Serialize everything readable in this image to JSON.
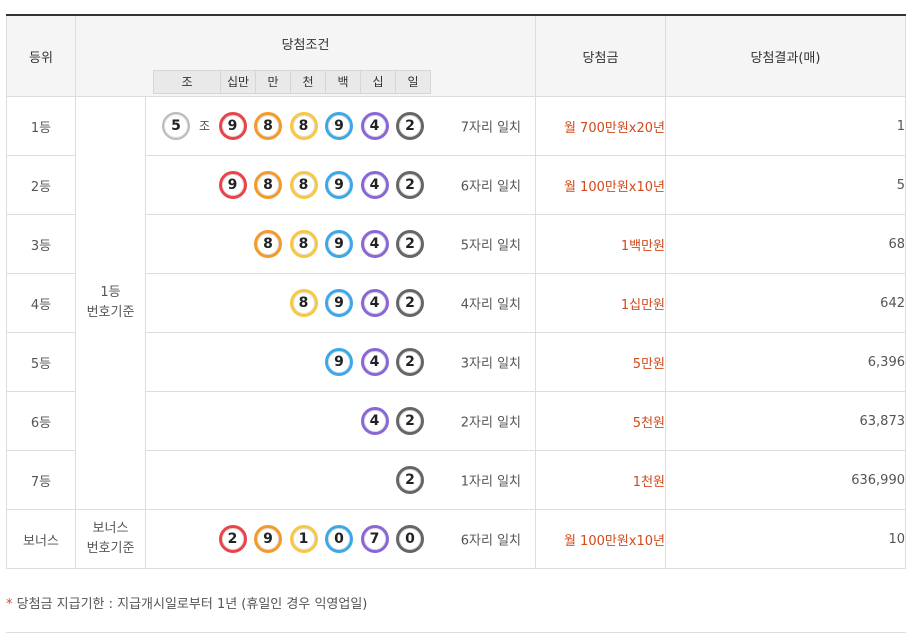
{
  "header": {
    "rank": "등위",
    "condition": "당첨조건",
    "prize": "당첨금",
    "result": "당첨결과(매)",
    "positions": [
      "조",
      "십만",
      "만",
      "천",
      "백",
      "십",
      "일"
    ]
  },
  "basis": {
    "main": "1등\n번호기준",
    "bonus": "보너스\n번호기준"
  },
  "jo_label": "조",
  "rows": [
    {
      "rank": "1등",
      "jo": "5",
      "digits": [
        "9",
        "8",
        "8",
        "9",
        "4",
        "2"
      ],
      "match": "7자리 일치",
      "prize": "월 700만원x20년",
      "result": "1"
    },
    {
      "rank": "2등",
      "digits": [
        "9",
        "8",
        "8",
        "9",
        "4",
        "2"
      ],
      "match": "6자리 일치",
      "prize": "월 100만원x10년",
      "result": "5"
    },
    {
      "rank": "3등",
      "digits": [
        "8",
        "8",
        "9",
        "4",
        "2"
      ],
      "match": "5자리 일치",
      "prize": "1백만원",
      "result": "68"
    },
    {
      "rank": "4등",
      "digits": [
        "8",
        "9",
        "4",
        "2"
      ],
      "match": "4자리 일치",
      "prize": "1십만원",
      "result": "642"
    },
    {
      "rank": "5등",
      "digits": [
        "9",
        "4",
        "2"
      ],
      "match": "3자리 일치",
      "prize": "5만원",
      "result": "6,396"
    },
    {
      "rank": "6등",
      "digits": [
        "4",
        "2"
      ],
      "match": "2자리 일치",
      "prize": "5천원",
      "result": "63,873"
    },
    {
      "rank": "7등",
      "digits": [
        "2"
      ],
      "match": "1자리 일치",
      "prize": "1천원",
      "result": "636,990"
    },
    {
      "rank": "보너스",
      "digits": [
        "2",
        "9",
        "1",
        "0",
        "7",
        "0"
      ],
      "match": "6자리 일치",
      "prize": "월 100만원x10년",
      "result": "10"
    }
  ],
  "ball_colors": {
    "position_order": [
      "red",
      "orange",
      "yellow",
      "blue",
      "purple",
      "gray"
    ],
    "red": "#e8444a",
    "orange": "#f49a2a",
    "yellow": "#f7c843",
    "blue": "#3ba8e8",
    "purple": "#8a67d6",
    "gray": "#666666"
  },
  "note": {
    "star": "*",
    "text": " 당첨금 지급기한 : 지급개시일로부터 1년 (휴일인 경우 익영업일)"
  }
}
